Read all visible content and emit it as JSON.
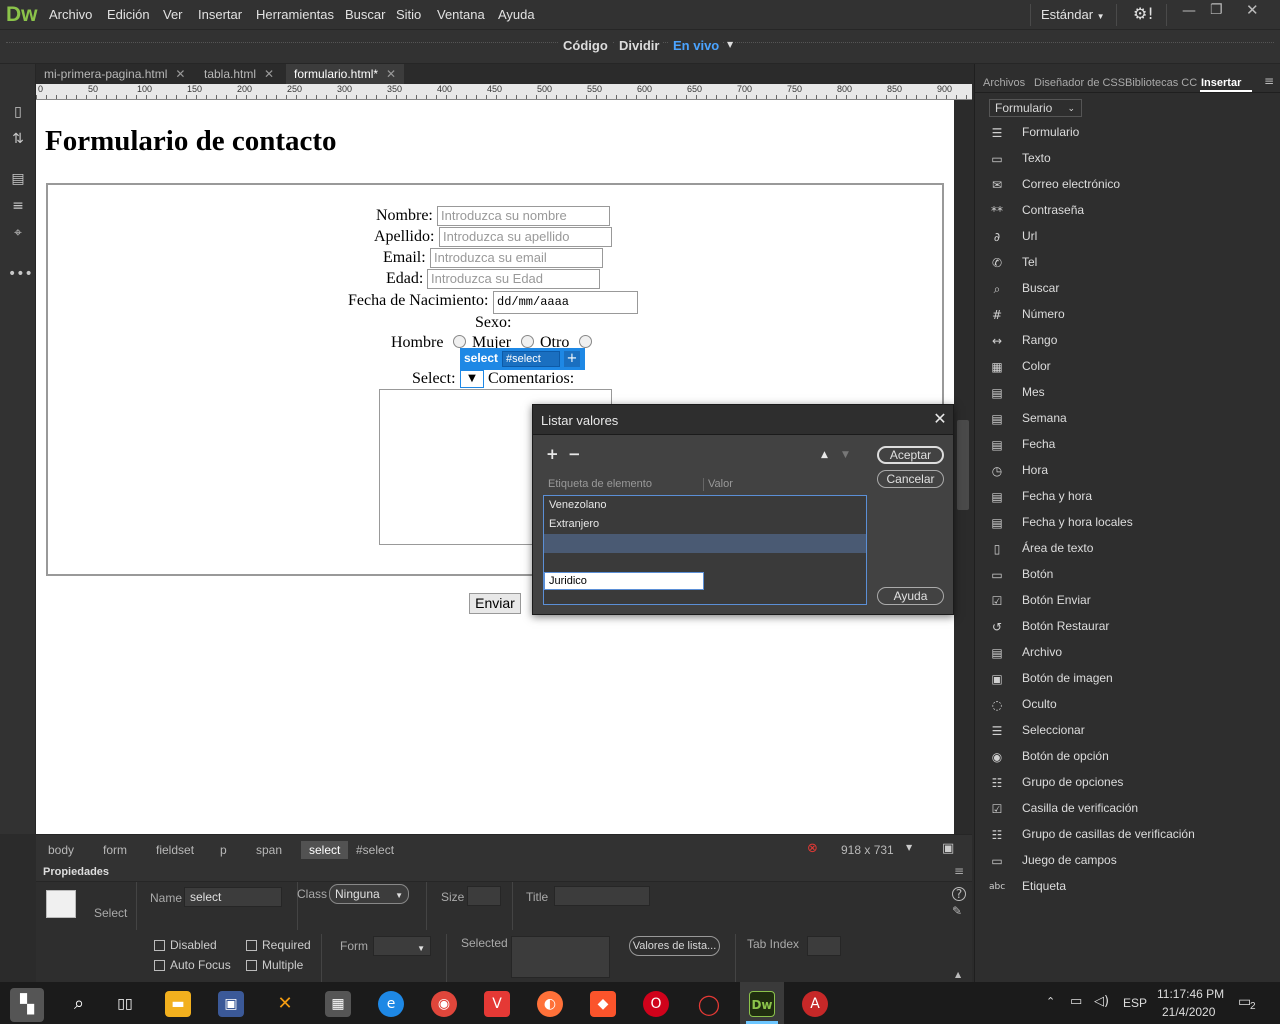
{
  "app": {
    "logo": "Dw",
    "menu": [
      "Archivo",
      "Edición",
      "Ver",
      "Insertar",
      "Herramientas",
      "Buscar",
      "Sitio",
      "Ventana",
      "Ayuda"
    ],
    "workspace": "Estándar"
  },
  "view_modes": {
    "code": "Código",
    "split": "Dividir",
    "live": "En vivo"
  },
  "doc_tabs": [
    "mi-primera-pagina.html",
    "tabla.html",
    "formulario.html*"
  ],
  "ruler": [
    "0",
    "50",
    "100",
    "150",
    "200",
    "250",
    "300",
    "350",
    "400",
    "450",
    "500",
    "550",
    "600",
    "650",
    "700",
    "750",
    "800",
    "850",
    "900"
  ],
  "page": {
    "title": "Formulario de contacto",
    "fields": [
      {
        "label": "Nombre:",
        "placeholder": "Introduzca su nombre"
      },
      {
        "label": "Apellido:",
        "placeholder": "Introduzca su apellido"
      },
      {
        "label": "Email:",
        "placeholder": "Introduzca su email"
      },
      {
        "label": "Edad:",
        "placeholder": "Introduzca su Edad"
      },
      {
        "label": "Fecha de Nacimiento:",
        "placeholder": "dd/mm/aaaa"
      }
    ],
    "sexo_label": "Sexo:",
    "radios": [
      "Hombre",
      "Mujer",
      "Otro"
    ],
    "select_label": "Select:",
    "select_arrow": "▼",
    "comments_label": "Comentarios:",
    "submit": "Enviar",
    "badge_tag": "select",
    "badge_id": "#select",
    "badge_plus": "+"
  },
  "status": {
    "breadcrumbs": [
      "body",
      "form",
      "fieldset",
      "p",
      "span",
      "select",
      "#select"
    ],
    "size": "918 x 731"
  },
  "props": {
    "header": "Propiedades",
    "type": "Select",
    "name_label": "Name",
    "name_value": "select",
    "class_label": "Class",
    "class_value": "Ninguna",
    "size_label": "Size",
    "title_label": "Title",
    "checks": [
      "Disabled",
      "Required",
      "Auto Focus",
      "Multiple"
    ],
    "form_label": "Form",
    "selected_label": "Selected",
    "list_values_btn": "Valores de lista...",
    "tabindex_label": "Tab Index"
  },
  "right_panel": {
    "tabs": [
      "Archivos",
      "Diseñador de CSS",
      "Bibliotecas CC",
      "Insertar"
    ],
    "dropdown": "Formulario",
    "items": [
      {
        "label": "Formulario",
        "icon": "☰"
      },
      {
        "label": "Texto",
        "icon": "▭"
      },
      {
        "label": "Correo electrónico",
        "icon": "✉"
      },
      {
        "label": "Contraseña",
        "icon": "**"
      },
      {
        "label": "Url",
        "icon": "∂"
      },
      {
        "label": "Tel",
        "icon": "✆"
      },
      {
        "label": "Buscar",
        "icon": "⌕"
      },
      {
        "label": "Número",
        "icon": "#"
      },
      {
        "label": "Rango",
        "icon": "↔"
      },
      {
        "label": "Color",
        "icon": "▦"
      },
      {
        "label": "Mes",
        "icon": "▤"
      },
      {
        "label": "Semana",
        "icon": "▤"
      },
      {
        "label": "Fecha",
        "icon": "▤"
      },
      {
        "label": "Hora",
        "icon": "◷"
      },
      {
        "label": "Fecha y hora",
        "icon": "▤"
      },
      {
        "label": "Fecha y hora locales",
        "icon": "▤"
      },
      {
        "label": "Área de texto",
        "icon": "▯"
      },
      {
        "label": "Botón",
        "icon": "▭"
      },
      {
        "label": "Botón Enviar",
        "icon": "☑"
      },
      {
        "label": "Botón Restaurar",
        "icon": "↺"
      },
      {
        "label": "Archivo",
        "icon": "▤"
      },
      {
        "label": "Botón de imagen",
        "icon": "▣"
      },
      {
        "label": "Oculto",
        "icon": "◌"
      },
      {
        "label": "Seleccionar",
        "icon": "☰"
      },
      {
        "label": "Botón de opción",
        "icon": "◉"
      },
      {
        "label": "Grupo de opciones",
        "icon": "☷"
      },
      {
        "label": "Casilla de verificación",
        "icon": "☑"
      },
      {
        "label": "Grupo de casillas de verificación",
        "icon": "☷"
      },
      {
        "label": "Juego de campos",
        "icon": "▭"
      },
      {
        "label": "Etiqueta",
        "icon": "abc"
      }
    ]
  },
  "dialog": {
    "title": "Listar valores",
    "close": "✕",
    "add": "+",
    "remove": "−",
    "up": "▲",
    "down": "▼",
    "col_label": "Etiqueta de elemento",
    "col_value": "Valor",
    "rows": [
      "Venezolano",
      "Extranjero",
      "Juridico"
    ],
    "ok": "Aceptar",
    "cancel": "Cancelar",
    "help": "Ayuda"
  },
  "taskbar": {
    "lang": "ESP",
    "time": "11:17:46 PM",
    "date": "21/4/2020",
    "badge": "2"
  },
  "colors": {
    "accent": "#1e88e5",
    "dw_green": "#8bc34a"
  }
}
